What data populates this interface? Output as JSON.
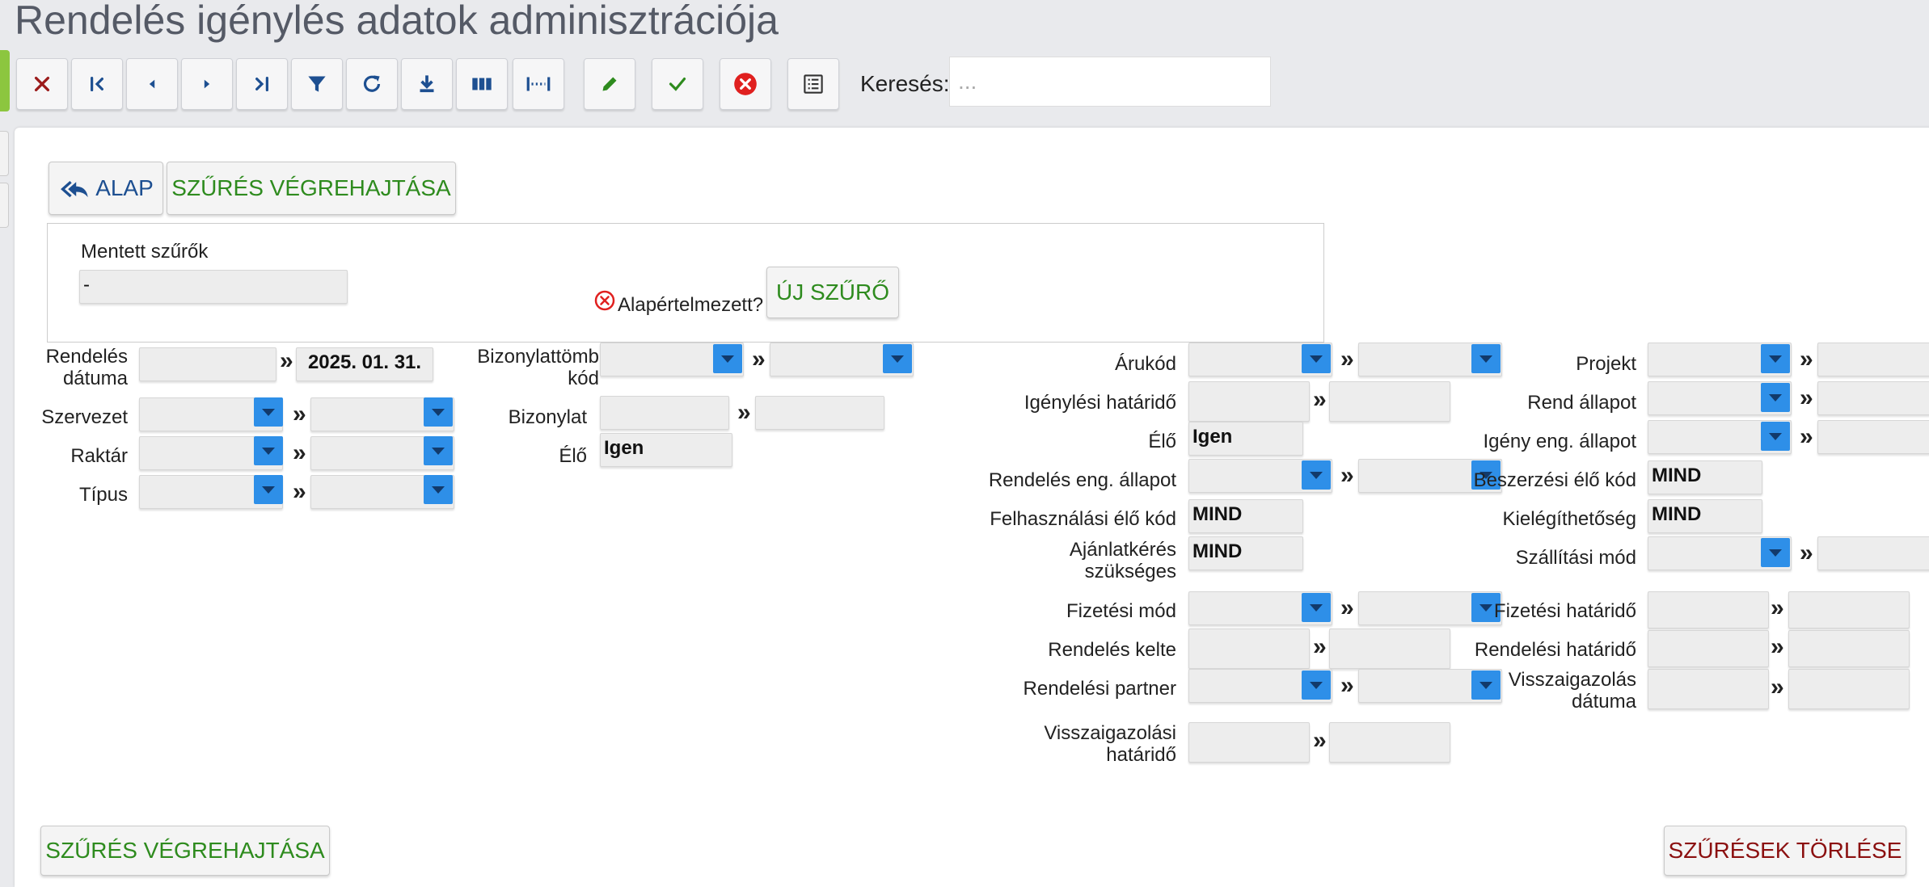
{
  "page_title": "Rendelés igénylés adatok adminisztrációja",
  "toolbar": {
    "icons": [
      "close-icon",
      "first-page-icon",
      "prev-icon",
      "next-icon",
      "last-page-icon",
      "filter-icon",
      "refresh-icon",
      "download-icon",
      "columns-icon",
      "column-width-icon",
      "edit-icon",
      "check-icon",
      "cancel-circle-icon",
      "list-icon"
    ],
    "search_label": "Keresés:",
    "search_placeholder": "..."
  },
  "buttons": {
    "alap": "ALAP",
    "szures_top": "SZŰRÉS VÉGREHAJTÁSA",
    "uj_szuro": "ÚJ SZŰRŐ",
    "szures_bottom": "SZŰRÉS VÉGREHAJTÁSA",
    "szuresek_torlese": "SZŰRÉSEK TÖRLÉSE"
  },
  "saved_filters": {
    "label": "Mentett szűrők",
    "value": "-",
    "default_label": "Alapértelmezett?"
  },
  "fields": {
    "rendeles_datuma": {
      "label_1": "Rendelés",
      "label_2": "dátuma",
      "to": "2025. 01. 31."
    },
    "szervezet": "Szervezet",
    "raktar": "Raktár",
    "tipus": "Típus",
    "bizonylattomb": {
      "label_1": "Bizonylattömb",
      "label_2": "kód"
    },
    "bizonylat": "Bizonylat",
    "elo_1": {
      "label": "Élő",
      "value": "Igen"
    },
    "arukod": "Árukód",
    "igenylesi_hatarido": "Igénylési határidő",
    "elo_2": {
      "label": "Élő",
      "value": "Igen"
    },
    "rendeles_eng_allapot": "Rendelés eng. állapot",
    "felhasznalasi_elo_kod": {
      "label": "Felhasználási élő kód",
      "value": "MIND"
    },
    "ajanlatkeres": {
      "label_1": "Ajánlatkérés",
      "label_2": "szükséges",
      "value": "MIND"
    },
    "fizetesi_mod": "Fizetési mód",
    "rendeles_kelte": "Rendelés kelte",
    "rendelesi_partner": "Rendelési partner",
    "visszaigazolasi_hatarido": {
      "label_1": "Visszaigazolási",
      "label_2": "határidő"
    },
    "projekt": "Projekt",
    "rend_allapot": "Rend állapot",
    "igeny_eng_allapot": "Igény eng. állapot",
    "beszerzesi_elo_kod": {
      "label": "Beszerzési élő kód",
      "value": "MIND"
    },
    "kielegithetoseg": {
      "label": "Kielégíthetőség",
      "value": "MIND"
    },
    "szallitasi_mod": "Szállítási mód",
    "fizetesi_hatarido": "Fizetési határidő",
    "rendelesi_hatarido": "Rendelési határidő",
    "visszaigazolas_datuma": {
      "label_1": "Visszaigazolás",
      "label_2": "dátuma"
    }
  },
  "range_separator": "»",
  "colors": {
    "accent_blue": "#2e8fe8",
    "action_green": "#2e8b1e",
    "danger_red": "#8b1010",
    "cancel_icon_red": "#e0201f"
  }
}
